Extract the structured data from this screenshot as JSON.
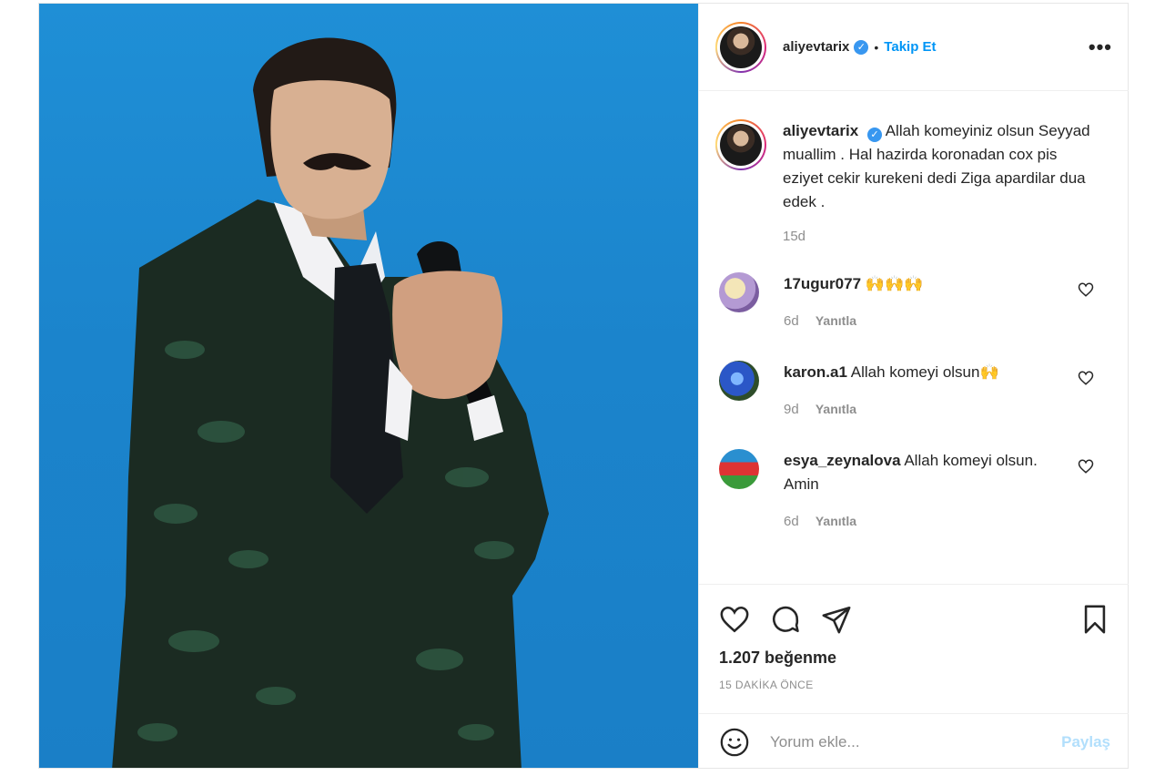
{
  "post": {
    "username": "aliyevtarix",
    "follow_label": "Takip Et",
    "separator": "•",
    "more_icon": "•••",
    "verified_icon": "✓"
  },
  "caption": {
    "username": "aliyevtarix",
    "text": "Allah komeyiniz olsun Seyyad muallim . Hal hazirda koronadan cox pis eziyet cekir kurekeni dedi Ziga apardilar dua edek .",
    "time": "15d"
  },
  "comments": [
    {
      "username": "17ugur077",
      "text": "🙌🙌🙌",
      "time": "6d",
      "reply_label": "Yanıtla"
    },
    {
      "username": "karon.a1",
      "text": "Allah komeyi olsun🙌",
      "time": "9d",
      "reply_label": "Yanıtla"
    },
    {
      "username": "esya_zeynalova",
      "text": "Allah komeyi olsun. Amin",
      "time": "6d",
      "reply_label": "Yanıtla"
    }
  ],
  "likes": {
    "count_text": "1.207 beğenme"
  },
  "timestamp": "15 DAKİKA ÖNCE",
  "comment_box": {
    "placeholder": "Yorum ekle...",
    "post_label": "Paylaş"
  },
  "colors": {
    "accent": "#0095f6",
    "sky": "#1f8fd6",
    "post_disabled": "#b2dffc",
    "muted": "#8e8e8e"
  }
}
